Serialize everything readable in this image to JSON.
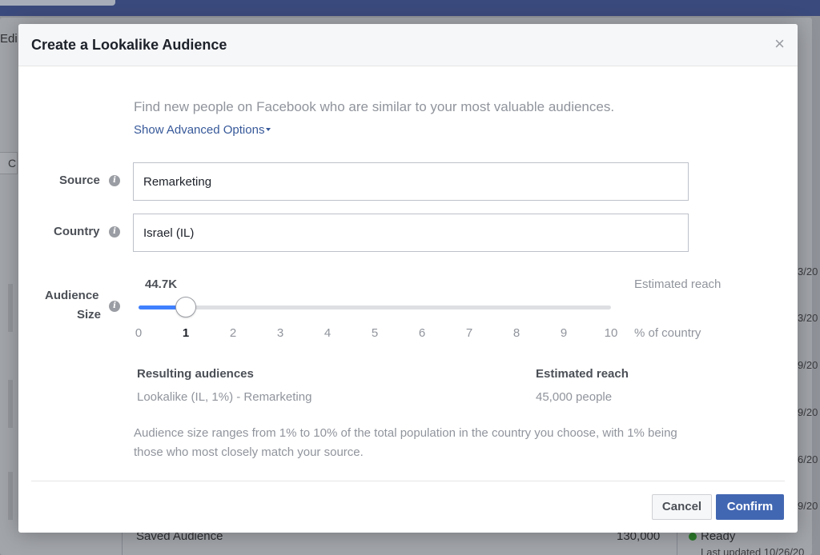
{
  "background": {
    "edit_fragment": "Edi",
    "c_fragment": "C",
    "dates": [
      "3/20",
      "3/20",
      "9/20",
      "9/20",
      "6/20",
      "9/20"
    ],
    "row": {
      "name": "Saved Audience",
      "size": "130,000",
      "status": "Ready",
      "updated": "Last updated 10/26/20"
    }
  },
  "modal": {
    "title": "Create a Lookalike Audience",
    "close_glyph": "×",
    "intro": "Find new people on Facebook who are similar to your most valuable audiences.",
    "advanced_label": "Show Advanced Options",
    "source": {
      "label": "Source",
      "value": "Remarketing"
    },
    "country": {
      "label": "Country",
      "value": "Israel (IL)"
    },
    "audience_size": {
      "label_line1": "Audience",
      "label_line2": "Size",
      "value_display": "44.7K",
      "estimated_reach_label": "Estimated reach",
      "selected_percent": 1,
      "max_percent": 10,
      "ticks": [
        "0",
        "1",
        "2",
        "3",
        "4",
        "5",
        "6",
        "7",
        "8",
        "9",
        "10"
      ],
      "unit_label": "% of country"
    },
    "results": {
      "audiences_header": "Resulting audiences",
      "audience_name": "Lookalike (IL, 1%) - Remarketing",
      "reach_header": "Estimated reach",
      "reach_value": "45,000 people"
    },
    "note": "Audience size ranges from 1% to 10% of the total population in the country you choose, with 1% being those who most closely match your source.",
    "buttons": {
      "cancel": "Cancel",
      "confirm": "Confirm"
    }
  },
  "colors": {
    "accent": "#4267b2",
    "link": "#365899",
    "slider_fill": "#4080ff",
    "status_ready": "#2b7a2a"
  }
}
